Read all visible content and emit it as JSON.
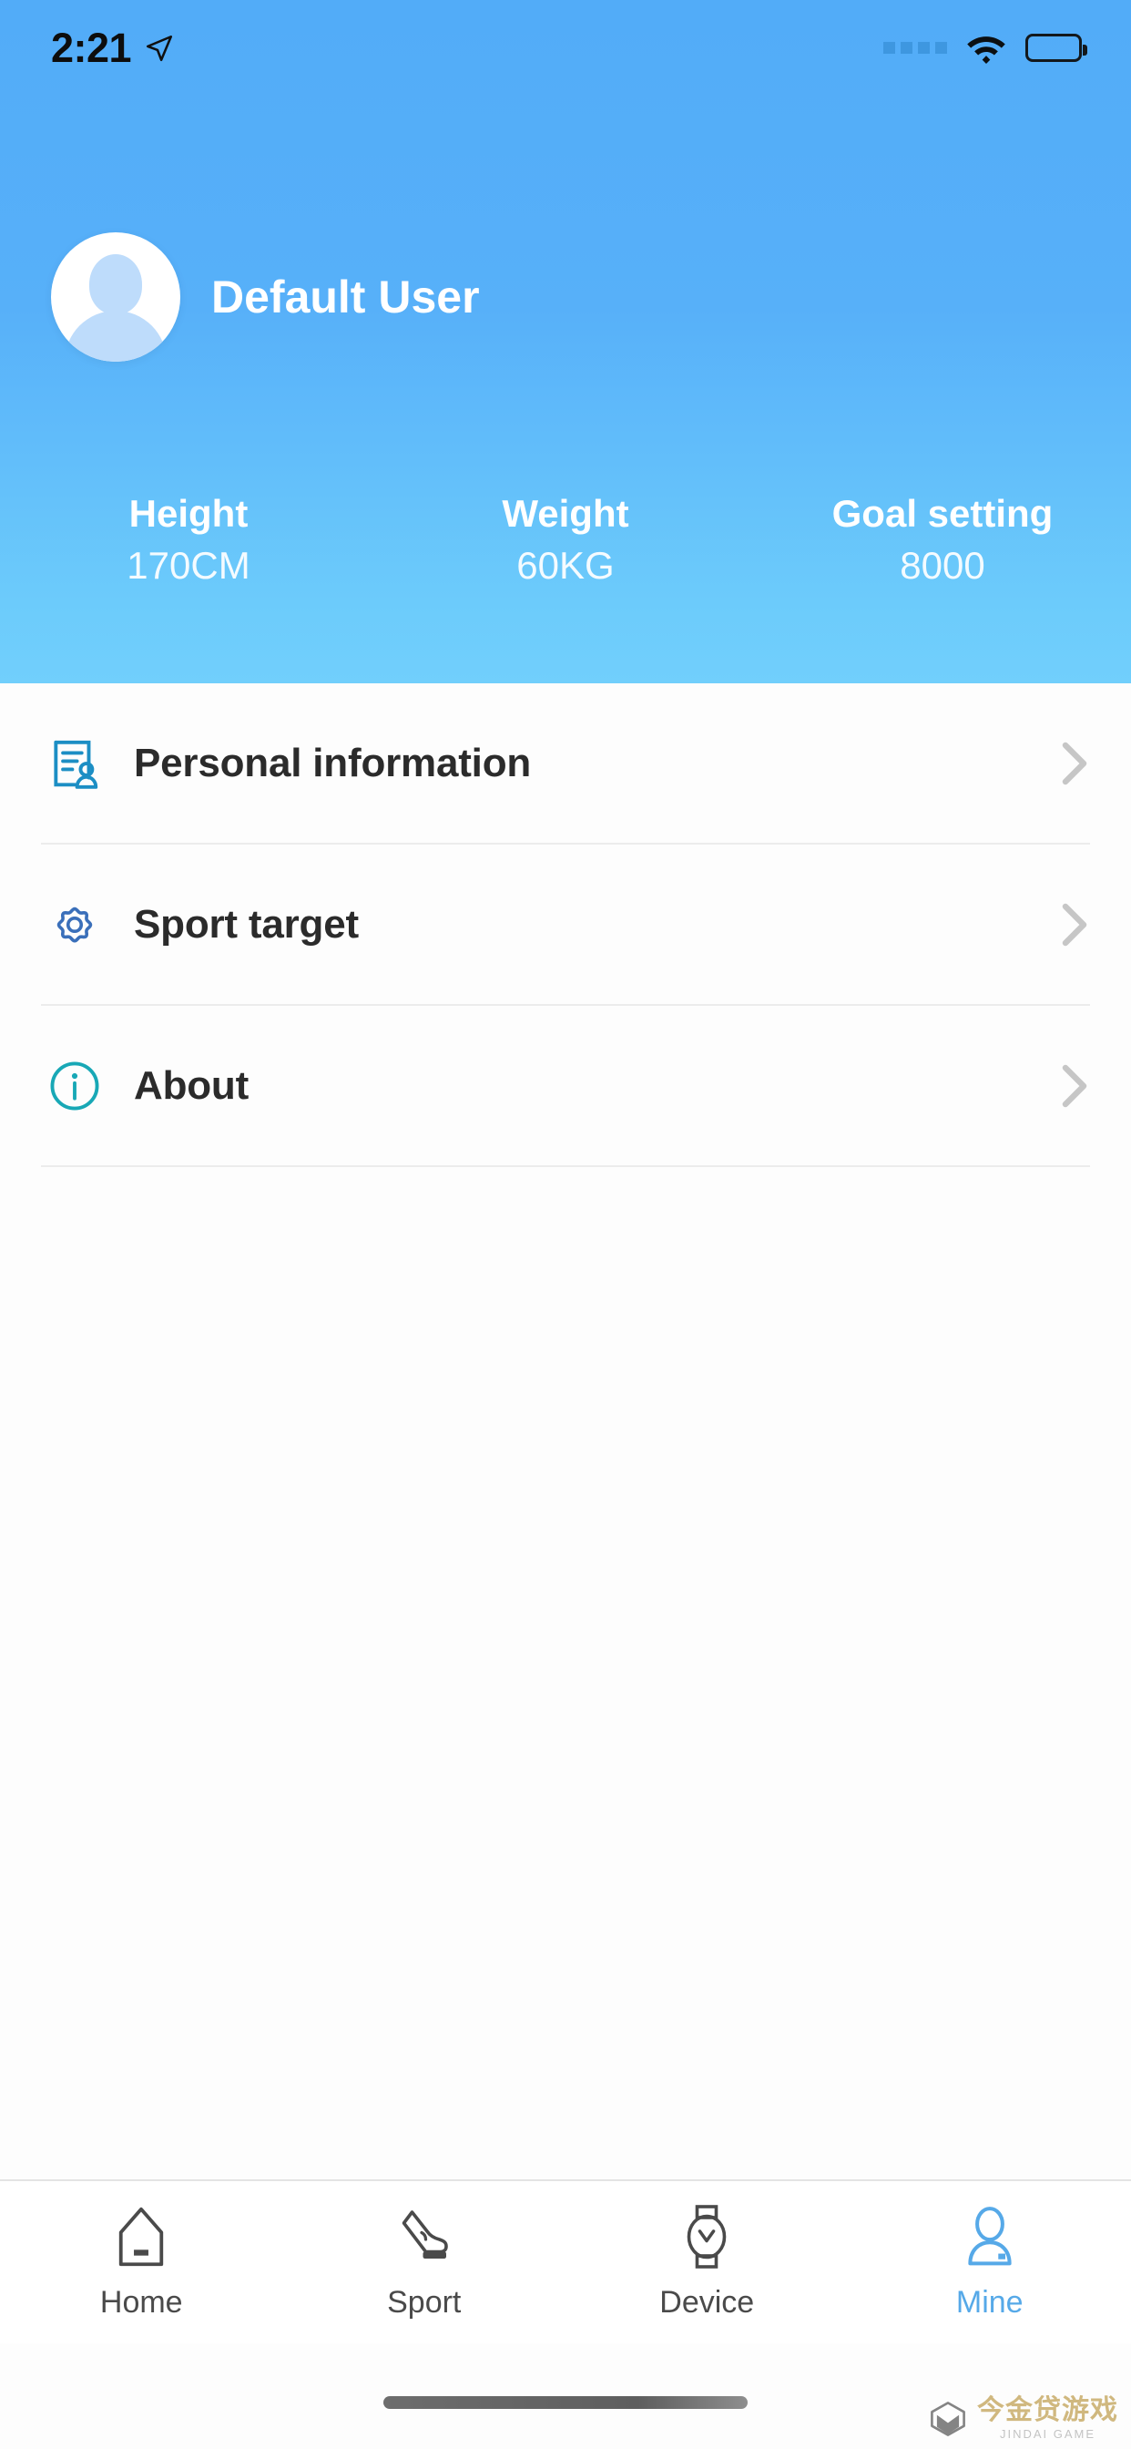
{
  "status_bar": {
    "time": "2:21",
    "location_icon": "location-arrow-icon",
    "signal_icon": "signal-dots-icon",
    "wifi_icon": "wifi-icon",
    "battery_icon": "battery-full-icon"
  },
  "header": {
    "background_top_color": "#52acf8",
    "background_bottom_color": "#71cffc",
    "avatar_icon": "default-avatar-icon",
    "username": "Default User",
    "stats": [
      {
        "label": "Height",
        "value": "170CM"
      },
      {
        "label": "Weight",
        "value": "60KG"
      },
      {
        "label": "Goal setting",
        "value": "8000"
      }
    ]
  },
  "menu": {
    "items": [
      {
        "label": "Personal information",
        "icon": "document-person-icon",
        "icon_color": "#1c8ec4",
        "chevron": "chevron-right-icon"
      },
      {
        "label": "Sport target",
        "icon": "gear-icon",
        "icon_color": "#3a6fba",
        "chevron": "chevron-right-icon"
      },
      {
        "label": "About",
        "icon": "info-circle-icon",
        "icon_color": "#18a8b6",
        "chevron": "chevron-right-icon"
      }
    ]
  },
  "tabbar": {
    "active_color": "#56a9e8",
    "inactive_color": "#4a4a4a",
    "tabs": [
      {
        "label": "Home",
        "icon": "home-icon",
        "active": false
      },
      {
        "label": "Sport",
        "icon": "shoe-icon",
        "active": false
      },
      {
        "label": "Device",
        "icon": "watch-icon",
        "active": false
      },
      {
        "label": "Mine",
        "icon": "person-icon",
        "active": true
      }
    ]
  },
  "watermark": {
    "cn": "今金贷游戏",
    "en": "JINDAI GAME"
  }
}
